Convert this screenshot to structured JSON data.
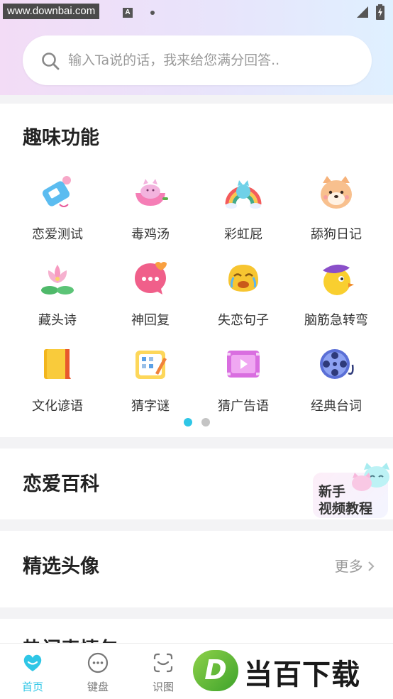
{
  "status_bar": {
    "watermark_url": "www.downbai.com",
    "a_badge": "A"
  },
  "search": {
    "placeholder": "输入Ta说的话，我来给您满分回答.."
  },
  "fun_section": {
    "title": "趣味功能",
    "items": [
      {
        "label": "恋爱测试",
        "icon": "love-test-icon"
      },
      {
        "label": "毒鸡汤",
        "icon": "poison-soup-icon"
      },
      {
        "label": "彩虹屁",
        "icon": "rainbow-icon"
      },
      {
        "label": "舔狗日记",
        "icon": "dog-diary-icon"
      },
      {
        "label": "藏头诗",
        "icon": "lotus-poem-icon"
      },
      {
        "label": "神回复",
        "icon": "reply-bubble-icon"
      },
      {
        "label": "失恋句子",
        "icon": "crying-face-icon"
      },
      {
        "label": "脑筋急转弯",
        "icon": "brain-teaser-icon"
      },
      {
        "label": "文化谚语",
        "icon": "book-icon"
      },
      {
        "label": "猜字谜",
        "icon": "word-puzzle-icon"
      },
      {
        "label": "猜广告语",
        "icon": "video-ad-icon"
      },
      {
        "label": "经典台词",
        "icon": "film-reel-icon"
      }
    ],
    "pager": {
      "pages": 2,
      "current": 1
    }
  },
  "love_section": {
    "title": "恋爱百科",
    "promo_line1": "新手",
    "promo_line2": "视频教程"
  },
  "avatar_section": {
    "title": "精选头像",
    "more": "更多"
  },
  "next_section": {
    "title": "热门表情包"
  },
  "tabbar": {
    "tabs": [
      {
        "label": "首页",
        "active": true
      },
      {
        "label": "键盘",
        "active": false
      },
      {
        "label": "识图",
        "active": false
      }
    ]
  },
  "logo": {
    "letter": "D",
    "text": "当百下载"
  },
  "colors": {
    "accent": "#2fc6e6",
    "pager_inactive": "#c4c4c4"
  }
}
